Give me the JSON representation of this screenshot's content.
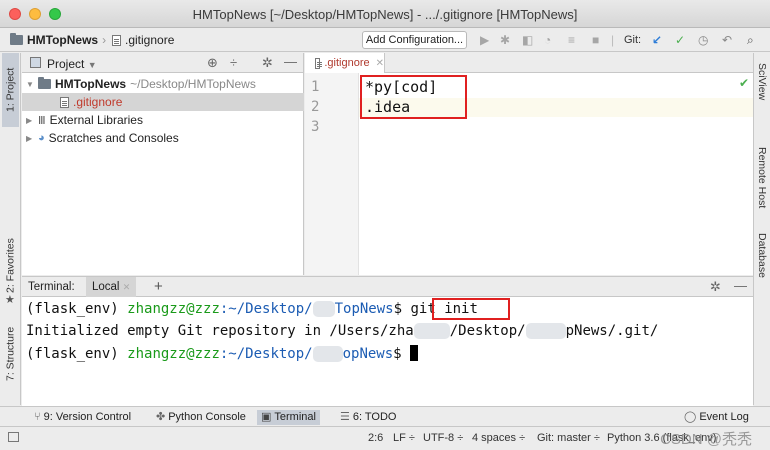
{
  "window": {
    "title": "HMTopNews [~/Desktop/HMTopNews] - .../.gitignore [HMTopNews]"
  },
  "navbar": {
    "breadcrumb_project": "HMTopNews",
    "breadcrumb_file": ".gitignore",
    "add_configuration": "Add Configuration...",
    "git_label": "Git:"
  },
  "left_strip": {
    "project_tab": "1: Project",
    "favorites_tab": "2: Favorites",
    "structure_tab": "7: Structure"
  },
  "right_strip": {
    "sciview_tab": "SciView",
    "remote_host_tab": "Remote Host",
    "database_tab": "Database"
  },
  "project_panel": {
    "title": "Project",
    "tree": [
      {
        "label": "HMTopNews",
        "path": "~/Desktop/HMTopNews"
      },
      {
        "label": ".gitignore"
      },
      {
        "label": "External Libraries"
      },
      {
        "label": "Scratches and Consoles"
      }
    ]
  },
  "editor": {
    "tab_label": ".gitignore",
    "line_numbers": [
      "1",
      "2",
      "3"
    ],
    "lines": [
      "*py[cod]",
      ".idea"
    ]
  },
  "terminal": {
    "title": "Terminal:",
    "session_tab": "Local",
    "add_tab": "+",
    "env": "(flask_env)",
    "user_host": "zhangzz@zzz",
    "line1_path_pre": ":~/Desktop/",
    "line1_path_post": "TopNews",
    "line1_dollar": "$",
    "command": "git init",
    "line2_pre": "Initialized empty Git repository in /Users/zha",
    "line2_mid": "/Desktop/",
    "line2_post": "pNews/.git/",
    "line3_path_pre": ":~/Desktop/",
    "line3_path_post": "opNews",
    "line3_dollar": "$"
  },
  "bottom_tabs": {
    "version_control": "9: Version Control",
    "python_console": "Python Console",
    "terminal": "Terminal",
    "todo": "6: TODO",
    "event_log": "Event Log"
  },
  "status": {
    "position": "2:6",
    "line_sep": "LF ÷",
    "encoding": "UTF-8 ÷",
    "indent": "4 spaces ÷",
    "git_branch": "Git: master ÷",
    "interpreter": "Python 3.6 (flask_env)",
    "watermark": "CSDN @秃秃"
  },
  "colors": {
    "prompt_user": "#1a9a1a",
    "prompt_path": "#1c5cb3",
    "highlight_box": "#e02020",
    "git_check": "#4caf50",
    "git_commit_arrow": "#2e7dd7"
  }
}
